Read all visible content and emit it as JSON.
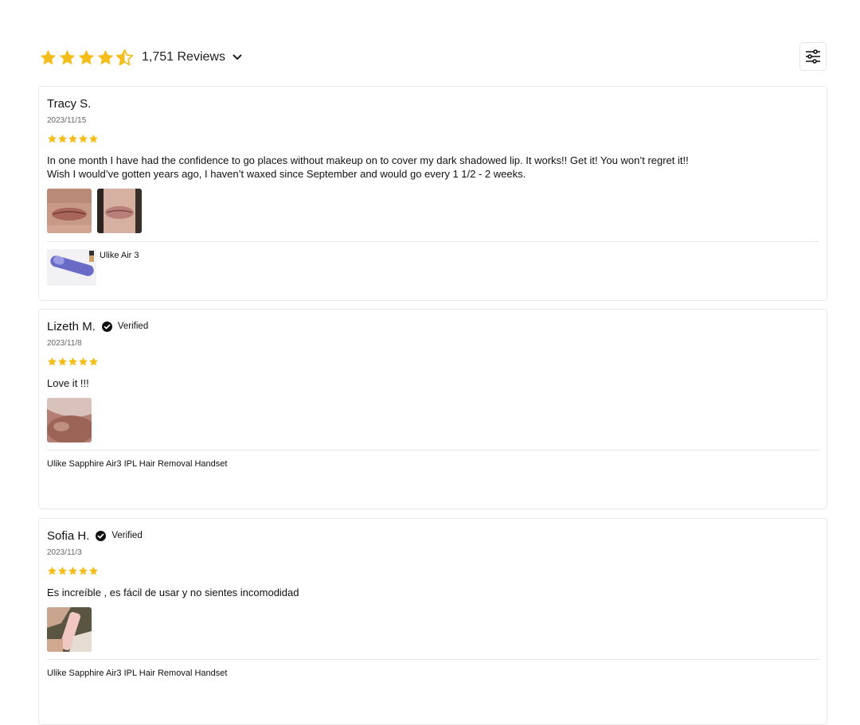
{
  "summary": {
    "rating": 4.5,
    "max_stars": 5,
    "count_label": "1,751 Reviews"
  },
  "colors": {
    "star": "#F4BD1B",
    "text": "#111111",
    "border": "#E8E8E8"
  },
  "icons": {
    "filter": "sliders-icon",
    "expand": "chevron-down-icon",
    "verified": "check-circle-icon"
  },
  "reviews": [
    {
      "author": "Tracy S.",
      "verified": false,
      "date": "2023/11/15",
      "rating": 5,
      "text": "In one month I have had the confidence to go places without makeup on to cover my dark shadowed lip. It works!! Get it! You won’t regret it!! Wish I would’ve gotten years ago, I haven’t waxed since September and would go every 1 1/2 - 2 weeks.",
      "product": "Ulike Air 3"
    },
    {
      "author": "Lizeth M.",
      "verified": true,
      "verified_label": "Verified",
      "date": "2023/11/8",
      "rating": 5,
      "text": "Love it !!!",
      "product": "Ulike Sapphire Air3 IPL Hair Removal Handset"
    },
    {
      "author": "Sofia H.",
      "verified": true,
      "verified_label": "Verified",
      "date": "2023/11/3",
      "rating": 5,
      "text": "Es increíble , es fácil de usar y no sientes incomodidad",
      "product": "Ulike Sapphire Air3 IPL Hair Removal Handset"
    }
  ]
}
